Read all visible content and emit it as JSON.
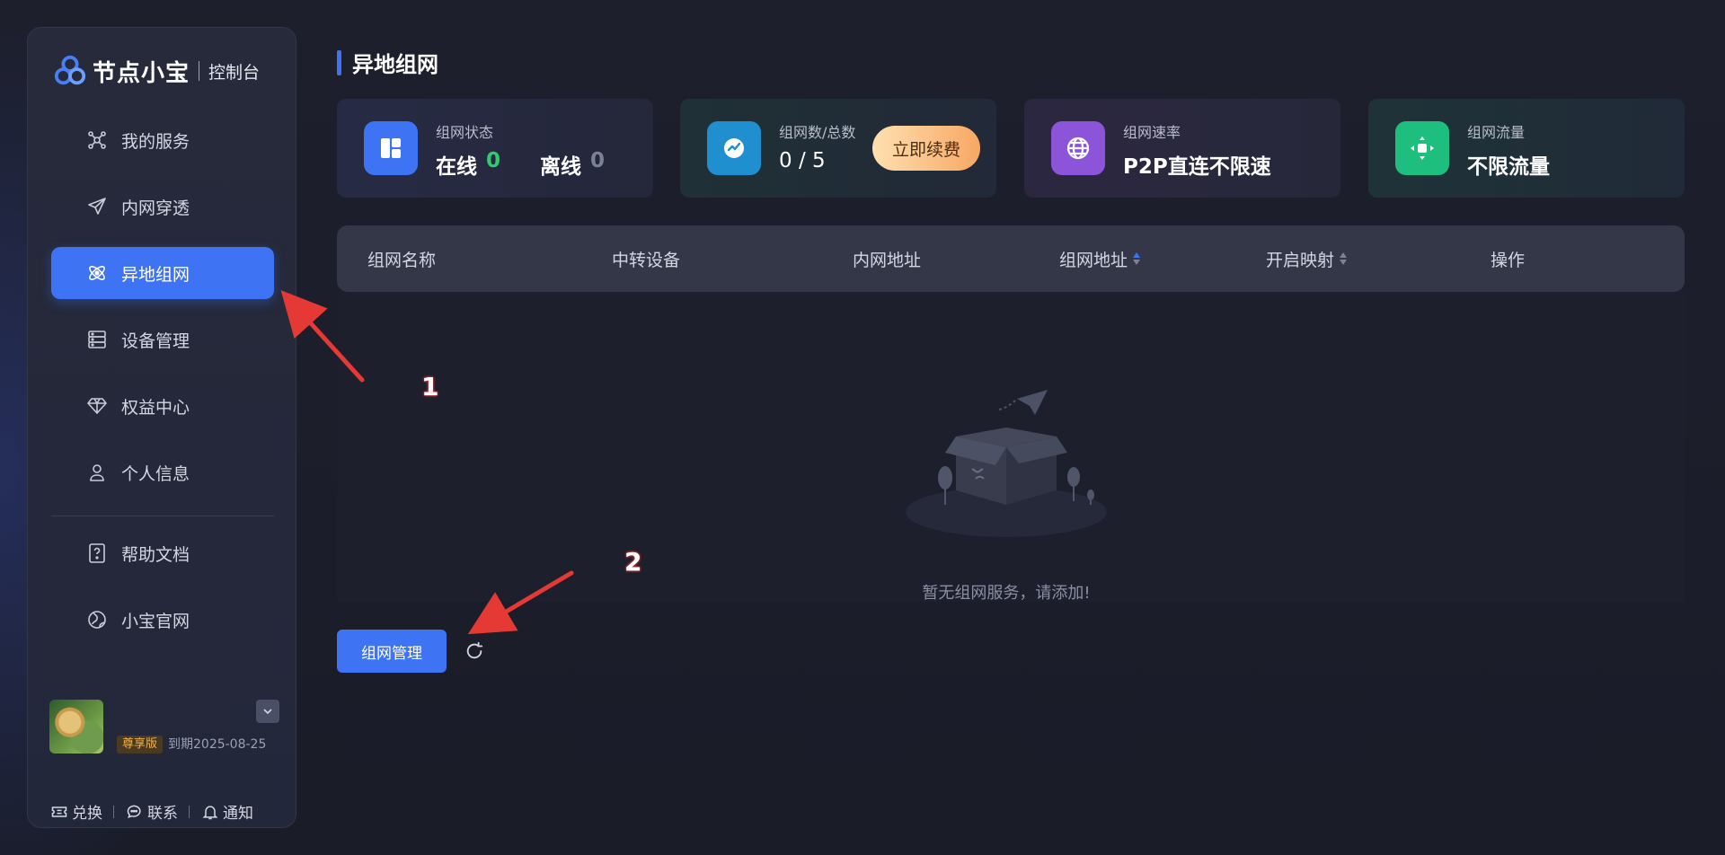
{
  "brand": {
    "name": "节点小宝",
    "sub": "控制台"
  },
  "sidebar": {
    "items": [
      {
        "label": "我的服务",
        "icon": "network-nodes-icon"
      },
      {
        "label": "内网穿透",
        "icon": "paper-plane-icon"
      },
      {
        "label": "异地组网",
        "icon": "orbit-icon",
        "active": true
      },
      {
        "label": "设备管理",
        "icon": "server-icon"
      },
      {
        "label": "权益中心",
        "icon": "diamond-icon"
      },
      {
        "label": "个人信息",
        "icon": "user-icon"
      },
      {
        "label": "帮助文档",
        "icon": "help-doc-icon"
      },
      {
        "label": "小宝官网",
        "icon": "globe-icon"
      }
    ]
  },
  "user": {
    "tier": "尊享版",
    "expire": "到期2025-08-25"
  },
  "footer": {
    "redeem": "兑换",
    "contact": "联系",
    "notify": "通知"
  },
  "page": {
    "title": "异地组网"
  },
  "cards": {
    "status": {
      "label": "组网状态",
      "online_label": "在线",
      "online_count": "0",
      "offline_label": "离线",
      "offline_count": "0"
    },
    "count": {
      "label": "组网数/总数",
      "value": "0 / 5",
      "renew_label": "立即续费"
    },
    "rate": {
      "label": "组网速率",
      "value": "P2P直连不限速"
    },
    "traffic": {
      "label": "组网流量",
      "value": "不限流量"
    }
  },
  "table": {
    "columns": [
      "组网名称",
      "中转设备",
      "内网地址",
      "组网地址",
      "开启映射",
      "操作"
    ],
    "empty_text": "暂无组网服务，请添加!"
  },
  "actions": {
    "manage_label": "组网管理"
  },
  "annotations": [
    "1",
    "2"
  ],
  "colors": {
    "accent": "#3e74f3",
    "online": "#2ecc71",
    "renew_start": "#ffe0b0",
    "renew_end": "#f8a764",
    "arrow": "#e53935"
  }
}
